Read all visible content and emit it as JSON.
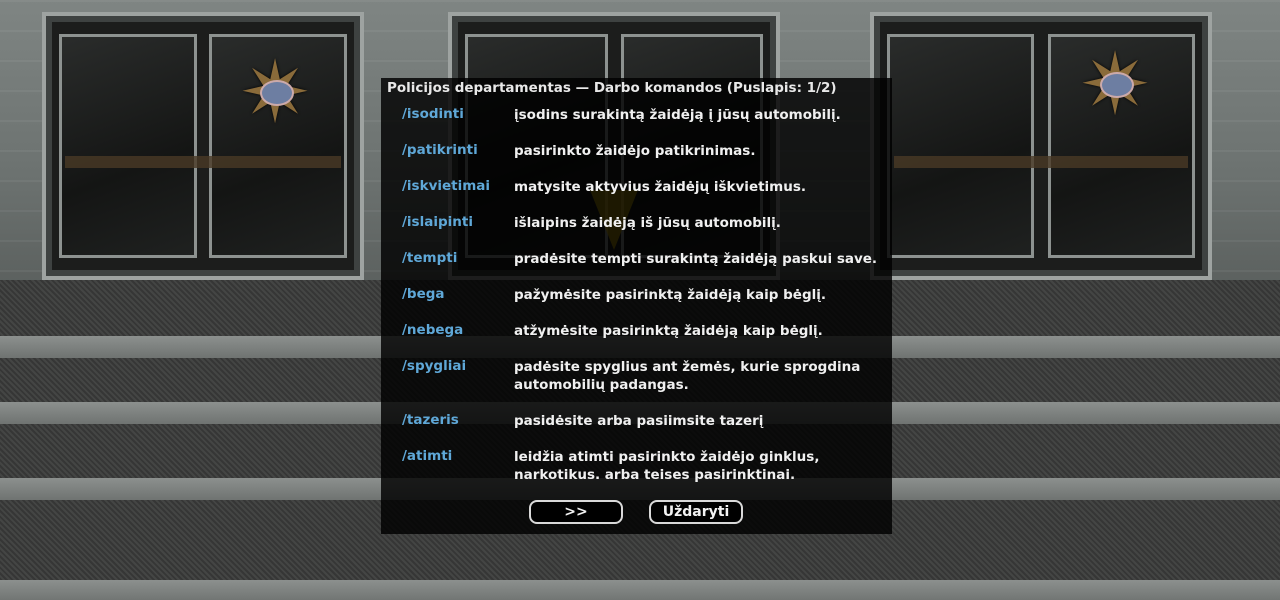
{
  "dialog": {
    "title": "Policijos departamentas — Darbo komandos (Puslapis: 1/2)",
    "commands": [
      {
        "name": "/isodinti",
        "desc": "įsodins surakintą žaidėją į jūsų automobilį."
      },
      {
        "name": "/patikrinti",
        "desc": "pasirinkto žaidėjo patikrinimas."
      },
      {
        "name": "/iskvietimai",
        "desc": "matysite aktyvius žaidėjų iškvietimus."
      },
      {
        "name": "/islaipinti",
        "desc": "išlaipins žaidėją iš jūsų automobilį."
      },
      {
        "name": "/tempti",
        "desc": "pradėsite tempti surakintą žaidėją paskui save."
      },
      {
        "name": "/bega",
        "desc": "pažymėsite pasirinktą žaidėją kaip bėglį."
      },
      {
        "name": "/nebega",
        "desc": "atžymėsite pasirinktą žaidėją kaip bėglį."
      },
      {
        "name": "/spygliai",
        "desc": "padėsite spyglius ant žemės, kurie sprogdina automobilių padangas."
      },
      {
        "name": "/tazeris",
        "desc": "pasidėsite arba pasiimsite tazerį"
      },
      {
        "name": "/atimti",
        "desc": "leidžia atimti pasirinkto žaidėjo ginklus, narkotikus. arba teises pasirinktinai."
      }
    ],
    "buttons": {
      "next": ">>",
      "close": "Uždaryti"
    }
  },
  "colors": {
    "command": "#5fa8d8",
    "text": "#f0f0f0",
    "dialog_bg": "rgba(0,0,0,0.82)"
  },
  "icons": [
    "sheriff-star-badge-icon",
    "yellow-marker-arrow-icon"
  ]
}
